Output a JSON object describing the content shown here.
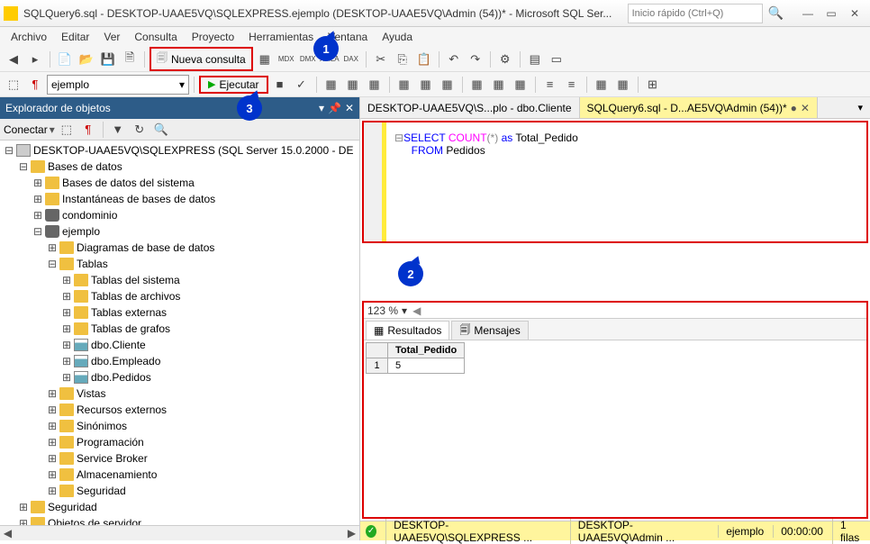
{
  "window": {
    "title": "SQLQuery6.sql - DESKTOP-UAAE5VQ\\SQLEXPRESS.ejemplo (DESKTOP-UAAE5VQ\\Admin (54))* - Microsoft SQL Ser...",
    "search_placeholder": "Inicio rápido (Ctrl+Q)"
  },
  "menu": [
    "Archivo",
    "Editar",
    "Ver",
    "Consulta",
    "Proyecto",
    "Herramientas",
    "Ventana",
    "Ayuda"
  ],
  "toolbar": {
    "nueva_consulta": "Nueva consulta"
  },
  "toolbar2": {
    "database": "ejemplo",
    "ejecutar": "Ejecutar"
  },
  "explorer": {
    "title": "Explorador de objetos",
    "connect": "Conectar",
    "server": "DESKTOP-UAAE5VQ\\SQLEXPRESS (SQL Server 15.0.2000 - DE",
    "databases": "Bases de datos",
    "sysdb": "Bases de datos del sistema",
    "snapshots": "Instantáneas de bases de datos",
    "db1": "condominio",
    "db2": "ejemplo",
    "diagrams": "Diagramas de base de datos",
    "tables": "Tablas",
    "systables": "Tablas del sistema",
    "filetables": "Tablas de archivos",
    "exttables": "Tablas externas",
    "graphtables": "Tablas de grafos",
    "t1": "dbo.Cliente",
    "t2": "dbo.Empleado",
    "t3": "dbo.Pedidos",
    "views": "Vistas",
    "extres": "Recursos externos",
    "synonyms": "Sinónimos",
    "prog": "Programación",
    "sb": "Service Broker",
    "storage": "Almacenamiento",
    "security": "Seguridad",
    "security2": "Seguridad",
    "srvobj": "Objetos de servidor"
  },
  "tabs": {
    "t1": "DESKTOP-UAAE5VQ\\S...plo - dbo.Cliente",
    "t2": "SQLQuery6.sql - D...AE5VQ\\Admin (54))*"
  },
  "sql": {
    "select": "SELECT",
    "count": "COUNT",
    "star": "(*)",
    "as": "as",
    "alias": "Total_Pedido",
    "from": "FROM",
    "table": "Pedidos"
  },
  "zoom": "123 %",
  "results": {
    "tab1": "Resultados",
    "tab2": "Mensajes",
    "col": "Total_Pedido",
    "rownum": "1",
    "val": "5"
  },
  "status": {
    "conn": "DESKTOP-UAAE5VQ\\SQLEXPRESS ...",
    "user": "DESKTOP-UAAE5VQ\\Admin ...",
    "db": "ejemplo",
    "time": "00:00:00",
    "rows": "1 filas"
  },
  "callouts": {
    "c1": "1",
    "c2": "2",
    "c3": "3"
  }
}
